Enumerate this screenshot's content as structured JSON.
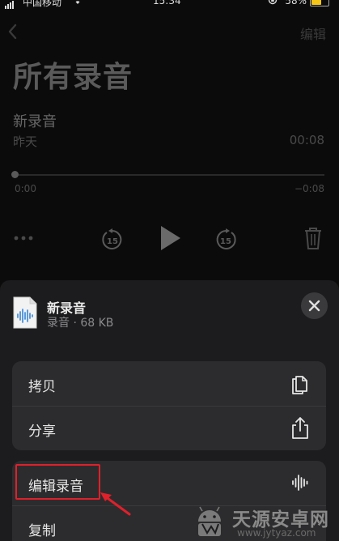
{
  "status_bar": {
    "carrier": "中国移动",
    "time": "15:34",
    "battery": "58%",
    "battery_level": 0.58
  },
  "nav": {
    "edit_label": "编辑",
    "title": "所有录音"
  },
  "recording": {
    "name": "新录音",
    "date": "昨天",
    "duration": "00:08",
    "time_start": "0:00",
    "time_end": "−0:08",
    "skip_seconds": "15"
  },
  "sheet": {
    "file_name": "新录音",
    "file_meta": "录音 · 68 KB",
    "actions_group1": [
      {
        "label": "拷贝",
        "icon": "copy-icon"
      },
      {
        "label": "分享",
        "icon": "share-icon"
      }
    ],
    "actions_group2": [
      {
        "label": "编辑录音",
        "icon": "waveform-icon"
      },
      {
        "label": "复制",
        "icon": ""
      }
    ]
  },
  "colors": {
    "annotation": "#e0202a",
    "battery": "#f5c518"
  },
  "watermark": {
    "name": "天源安卓网",
    "url": "www.jytyaz.com"
  }
}
